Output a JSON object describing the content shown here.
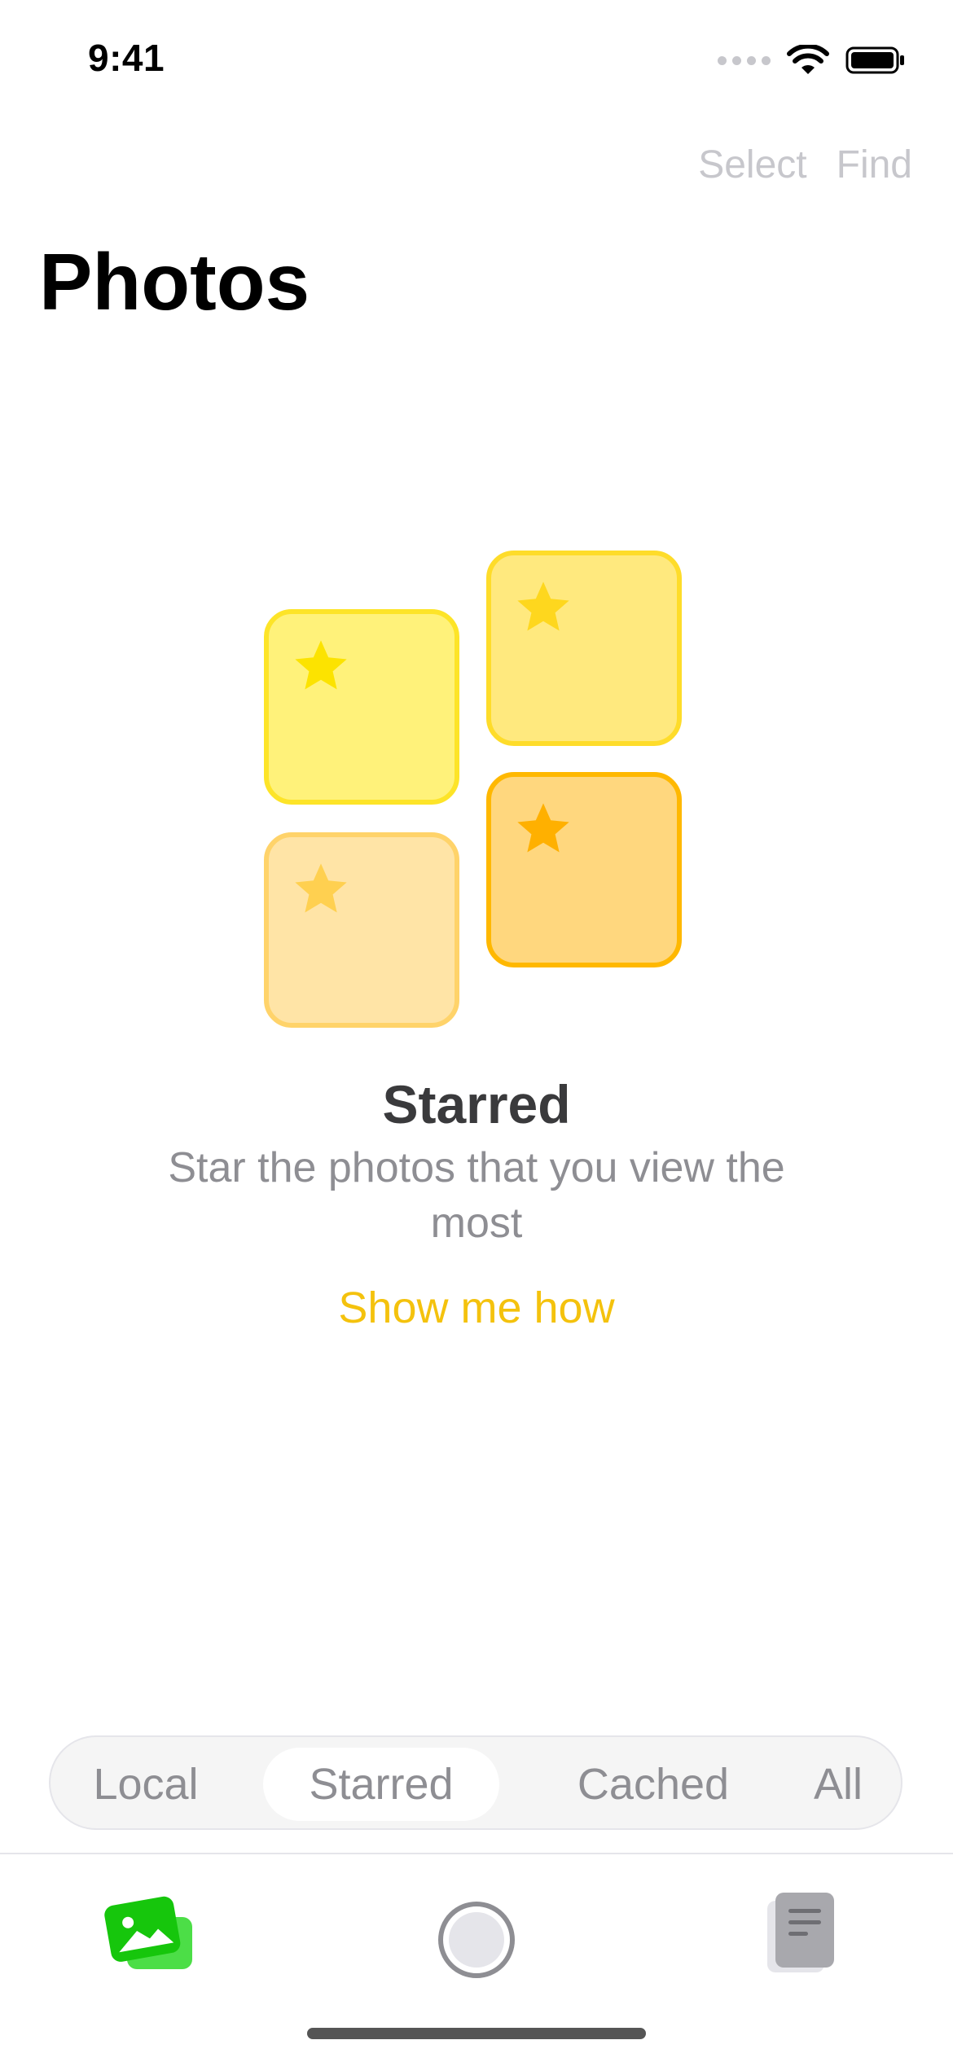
{
  "status_bar": {
    "time": "9:41"
  },
  "nav": {
    "select_label": "Select",
    "find_label": "Find"
  },
  "page": {
    "title": "Photos"
  },
  "empty_state": {
    "title": "Starred",
    "description": "Star the photos that you view the most",
    "action_label": "Show me how"
  },
  "segments": {
    "items": [
      "Local",
      "Starred",
      "Cached",
      "All"
    ],
    "selected": "Starred"
  },
  "tabbar": {
    "icons": [
      "photos-icon",
      "camera-shutter-icon",
      "documents-icon"
    ]
  },
  "colors": {
    "accent": "#f4c20d",
    "tab_active": "#16c60c",
    "muted": "#8e8e93"
  }
}
